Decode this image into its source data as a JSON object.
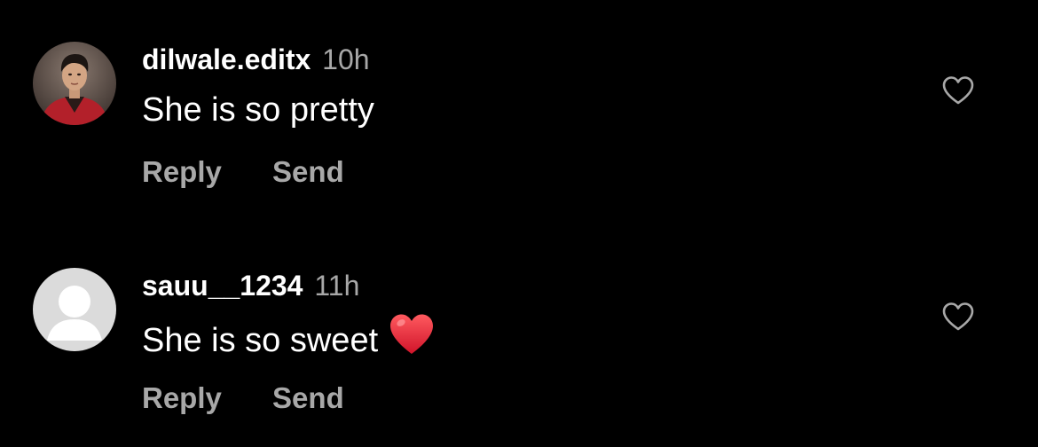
{
  "comments": [
    {
      "username": "dilwale.editx",
      "time": "10h",
      "text": "She is so pretty",
      "reply_label": "Reply",
      "send_label": "Send",
      "avatar": "profile-photo",
      "like_icon": "heart-outline-icon"
    },
    {
      "username": "sauu__1234",
      "time": "11h",
      "text": "She is so sweet",
      "emoji": "red-heart-emoji",
      "reply_label": "Reply",
      "send_label": "Send",
      "avatar": "default-avatar",
      "like_icon": "heart-outline-icon"
    }
  ],
  "colors": {
    "background": "#000000",
    "primary_text": "#ffffff",
    "secondary_text": "#a8a8a8",
    "heart_emoji": "#e6283a"
  }
}
